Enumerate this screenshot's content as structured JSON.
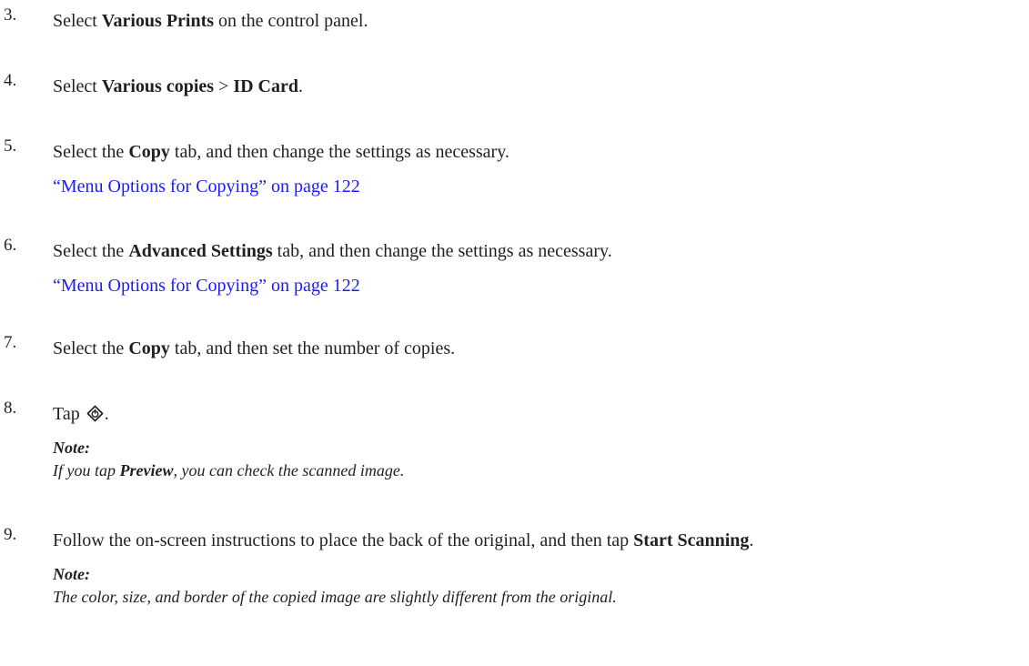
{
  "steps": [
    {
      "number": "3.",
      "segments": [
        {
          "text": "Select "
        },
        {
          "text": "Various Prints",
          "bold": true
        },
        {
          "text": " on the control panel."
        }
      ]
    },
    {
      "number": "4.",
      "segments": [
        {
          "text": "Select "
        },
        {
          "text": "Various copies",
          "bold": true
        },
        {
          "text": " > "
        },
        {
          "text": "ID Card",
          "bold": true
        },
        {
          "text": "."
        }
      ]
    },
    {
      "number": "5.",
      "segments": [
        {
          "text": "Select the "
        },
        {
          "text": "Copy",
          "bold": true
        },
        {
          "text": " tab, and then change the settings as necessary."
        }
      ],
      "link": "“Menu Options for Copying” on page 122"
    },
    {
      "number": "6.",
      "segments": [
        {
          "text": "Select the "
        },
        {
          "text": "Advanced Settings",
          "bold": true
        },
        {
          "text": " tab, and then change the settings as necessary."
        }
      ],
      "link": "“Menu Options for Copying” on page 122"
    },
    {
      "number": "7.",
      "segments": [
        {
          "text": "Select the "
        },
        {
          "text": "Copy",
          "bold": true
        },
        {
          "text": " tab, and then set the number of copies."
        }
      ]
    },
    {
      "number": "8.",
      "segments": [
        {
          "text": "Tap "
        },
        {
          "icon": "start-button-icon"
        },
        {
          "text": "."
        }
      ],
      "note": {
        "label": "Note:",
        "segments": [
          {
            "text": "If you tap "
          },
          {
            "text": "Preview",
            "bold": true
          },
          {
            "text": ", you can check the scanned image."
          }
        ]
      }
    },
    {
      "number": "9.",
      "segments": [
        {
          "text": "Follow the on-screen instructions to place the back of the original, and then tap "
        },
        {
          "text": "Start Scanning",
          "bold": true
        },
        {
          "text": "."
        }
      ],
      "note": {
        "label": "Note:",
        "segments": [
          {
            "text": "The color, size, and border of the copied image are slightly different from the original."
          }
        ]
      }
    }
  ],
  "colors": {
    "text": "#231f20",
    "link": "#1a1aff"
  }
}
